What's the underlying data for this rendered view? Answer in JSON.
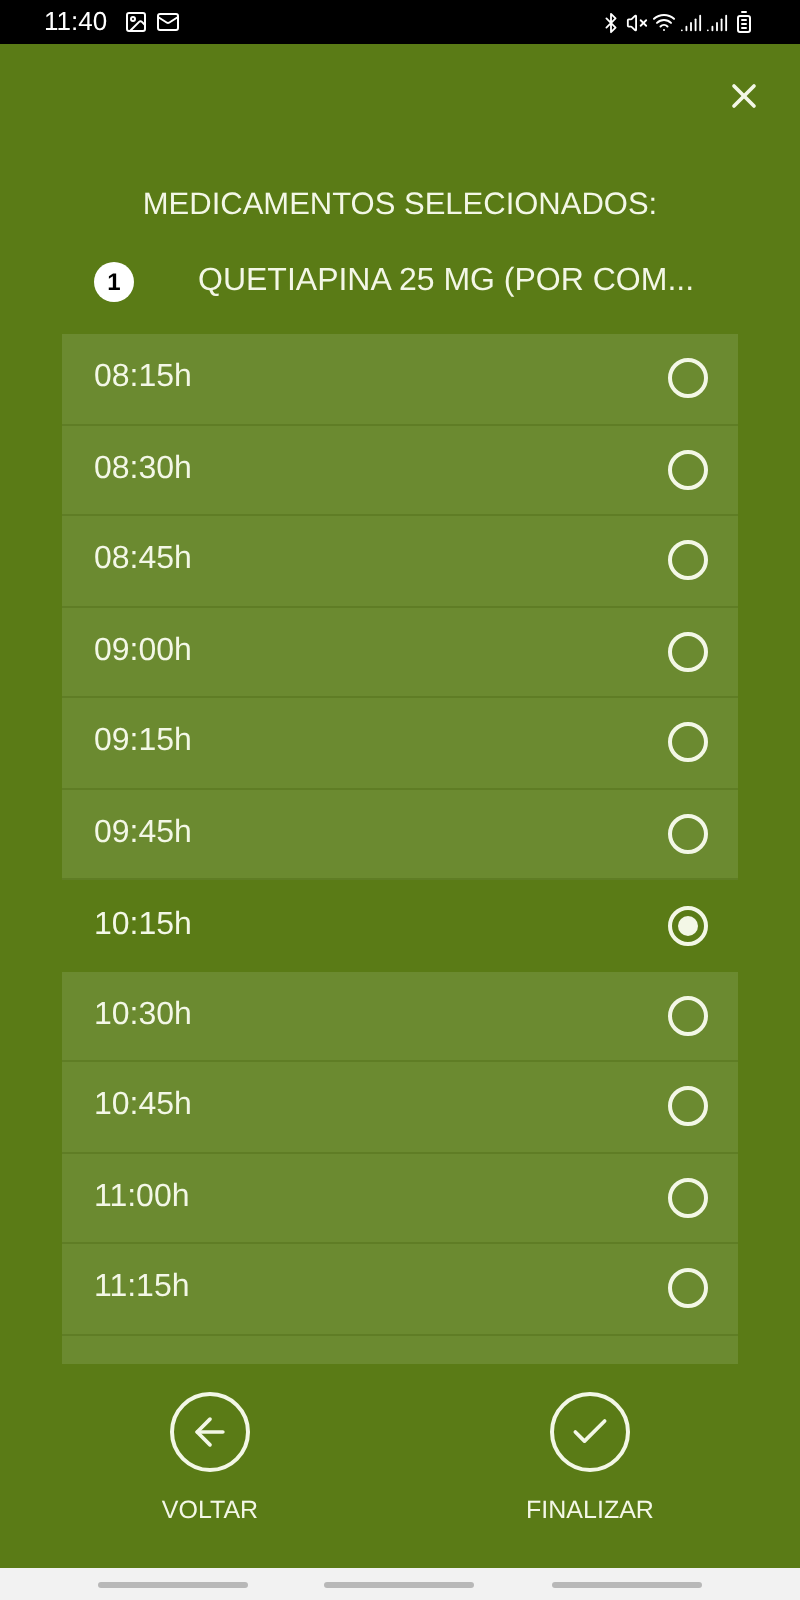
{
  "status_bar": {
    "time": "11:40"
  },
  "title": "MEDICAMENTOS SELECIONADOS:",
  "medications": [
    {
      "number": "1",
      "name": "QUETIAPINA 25 MG (POR COM..."
    }
  ],
  "times": [
    {
      "label": "08:15h",
      "selected": false
    },
    {
      "label": "08:30h",
      "selected": false
    },
    {
      "label": "08:45h",
      "selected": false
    },
    {
      "label": "09:00h",
      "selected": false
    },
    {
      "label": "09:15h",
      "selected": false
    },
    {
      "label": "09:45h",
      "selected": false
    },
    {
      "label": "10:15h",
      "selected": true
    },
    {
      "label": "10:30h",
      "selected": false
    },
    {
      "label": "10:45h",
      "selected": false
    },
    {
      "label": "11:00h",
      "selected": false
    },
    {
      "label": "11:15h",
      "selected": false
    }
  ],
  "actions": [
    {
      "kind": "back",
      "label": "VOLTAR"
    },
    {
      "kind": "finish",
      "label": "FINALIZAR"
    }
  ]
}
